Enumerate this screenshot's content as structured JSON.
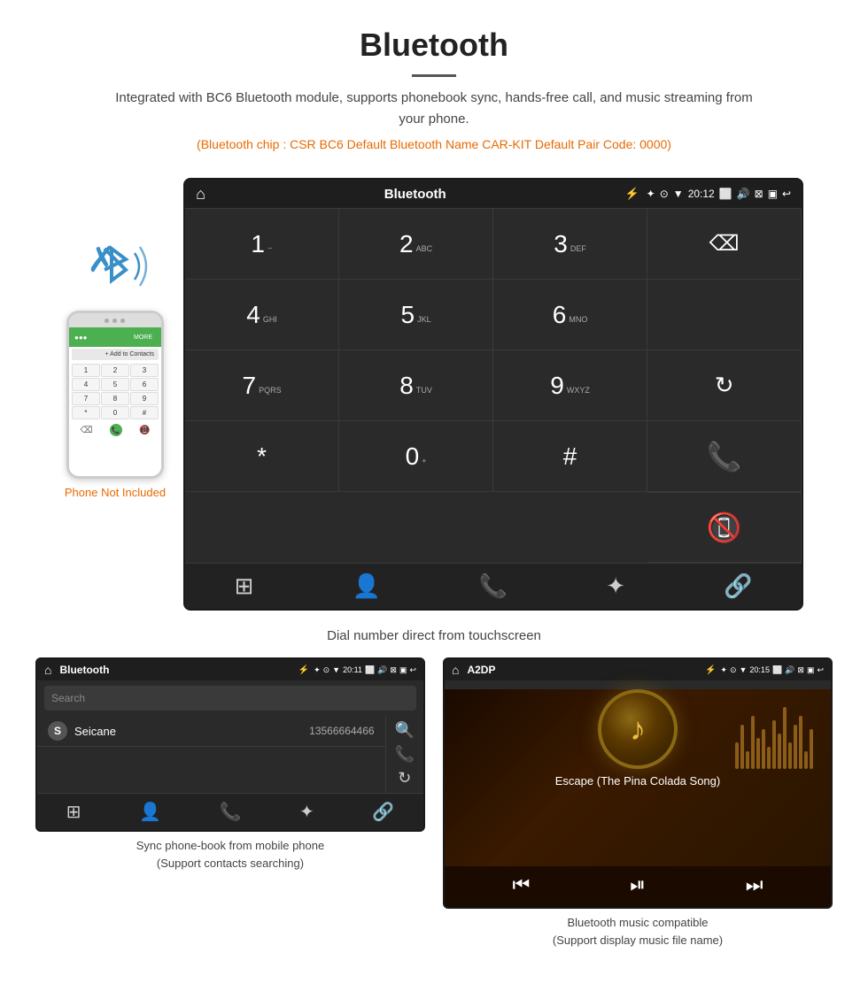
{
  "header": {
    "title": "Bluetooth",
    "description": "Integrated with BC6 Bluetooth module, supports phonebook sync, hands-free call, and music streaming from your phone.",
    "specs": "(Bluetooth chip : CSR BC6    Default Bluetooth Name CAR-KIT    Default Pair Code: 0000)"
  },
  "phone_label": "Phone Not Included",
  "main_screen": {
    "status_bar": {
      "title": "Bluetooth",
      "time": "20:12"
    },
    "dial_keys": [
      {
        "main": "1",
        "sub": ""
      },
      {
        "main": "2",
        "sub": "ABC"
      },
      {
        "main": "3",
        "sub": "DEF"
      },
      {
        "main": "",
        "sub": ""
      },
      {
        "main": "4",
        "sub": "GHI"
      },
      {
        "main": "5",
        "sub": "JKL"
      },
      {
        "main": "6",
        "sub": "MNO"
      },
      {
        "main": "",
        "sub": ""
      },
      {
        "main": "7",
        "sub": "PQRS"
      },
      {
        "main": "8",
        "sub": "TUV"
      },
      {
        "main": "9",
        "sub": "WXYZ"
      },
      {
        "main": "",
        "sub": "reload"
      },
      {
        "main": "*",
        "sub": ""
      },
      {
        "main": "0",
        "sub": "+"
      },
      {
        "main": "#",
        "sub": ""
      },
      {
        "main": "",
        "sub": "call_green"
      },
      {
        "main": "",
        "sub": "call_red"
      }
    ]
  },
  "main_caption": "Dial number direct from touchscreen",
  "phonebook_screen": {
    "status_bar": {
      "title": "Bluetooth",
      "time": "20:11"
    },
    "search_placeholder": "Search",
    "contacts": [
      {
        "letter": "S",
        "name": "Seicane",
        "number": "13566664466"
      }
    ]
  },
  "phonebook_caption": "Sync phone-book from mobile phone\n(Support contacts searching)",
  "music_screen": {
    "status_bar": {
      "title": "A2DP",
      "time": "20:15"
    },
    "song_title": "Escape (The Pina Colada Song)"
  },
  "music_caption": "Bluetooth music compatible\n(Support display music file name)"
}
